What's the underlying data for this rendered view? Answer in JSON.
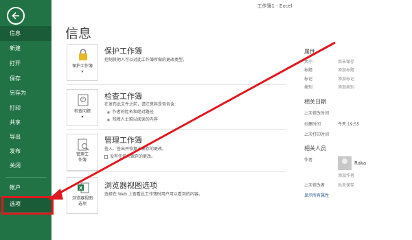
{
  "window_title": "工作簿1 - Excel",
  "sidebar": {
    "items": [
      {
        "label": "信息",
        "active": true
      },
      {
        "label": "新建"
      },
      {
        "label": "打开"
      },
      {
        "label": "保存"
      },
      {
        "label": "另存为"
      },
      {
        "label": "打印"
      },
      {
        "label": "共享"
      },
      {
        "label": "导出"
      },
      {
        "label": "发布"
      },
      {
        "label": "关闭"
      },
      {
        "label": "帐户"
      },
      {
        "label": "选项"
      }
    ]
  },
  "main": {
    "title": "信息",
    "protect": {
      "icon_label": "保护工作簿",
      "heading": "保护工作簿",
      "desc": "控制其他人可以对此工作簿所做的更改类型。"
    },
    "inspect": {
      "icon_label": "检查问题",
      "heading": "检查工作簿",
      "desc": "在发布此文件之前，请注意其是否包含:",
      "bullets": [
        "作者的姓名和绝对路径",
        "残障人士难以阅读的内容"
      ]
    },
    "manage": {
      "icon_label_1": "管理工",
      "icon_label_2": "作簿",
      "heading": "管理工作簿",
      "desc": "签入、签出并恢复未保存的更改。",
      "bullet": "没有任何未保存的更改。"
    },
    "browser": {
      "icon_label_1": "浏览器视图",
      "icon_label_2": "选项",
      "heading": "浏览器视图选项",
      "desc": "选择在 Web 上查看此工作簿时用户可以看到的内容。"
    }
  },
  "properties": {
    "heading": "属性",
    "rows": [
      {
        "label": "大小",
        "value": "尚未保存"
      },
      {
        "label": "标题",
        "value": "添加标题"
      },
      {
        "label": "标记",
        "value": "添加标记"
      },
      {
        "label": "类别",
        "value": "添加类别"
      }
    ],
    "dates_heading": "相关日期",
    "dates": [
      {
        "label": "上次修改时间",
        "value": ""
      },
      {
        "label": "创建时间",
        "value": "今天 19:55"
      },
      {
        "label": "上次打印时间",
        "value": ""
      }
    ],
    "people_heading": "相关人员",
    "author_label": "作者",
    "author_name": "Raka",
    "add_author": "添加作者",
    "last_modified_by_label": "上次修改者",
    "last_modified_by_value": "尚未保存",
    "show_all": "显示所有属性"
  }
}
